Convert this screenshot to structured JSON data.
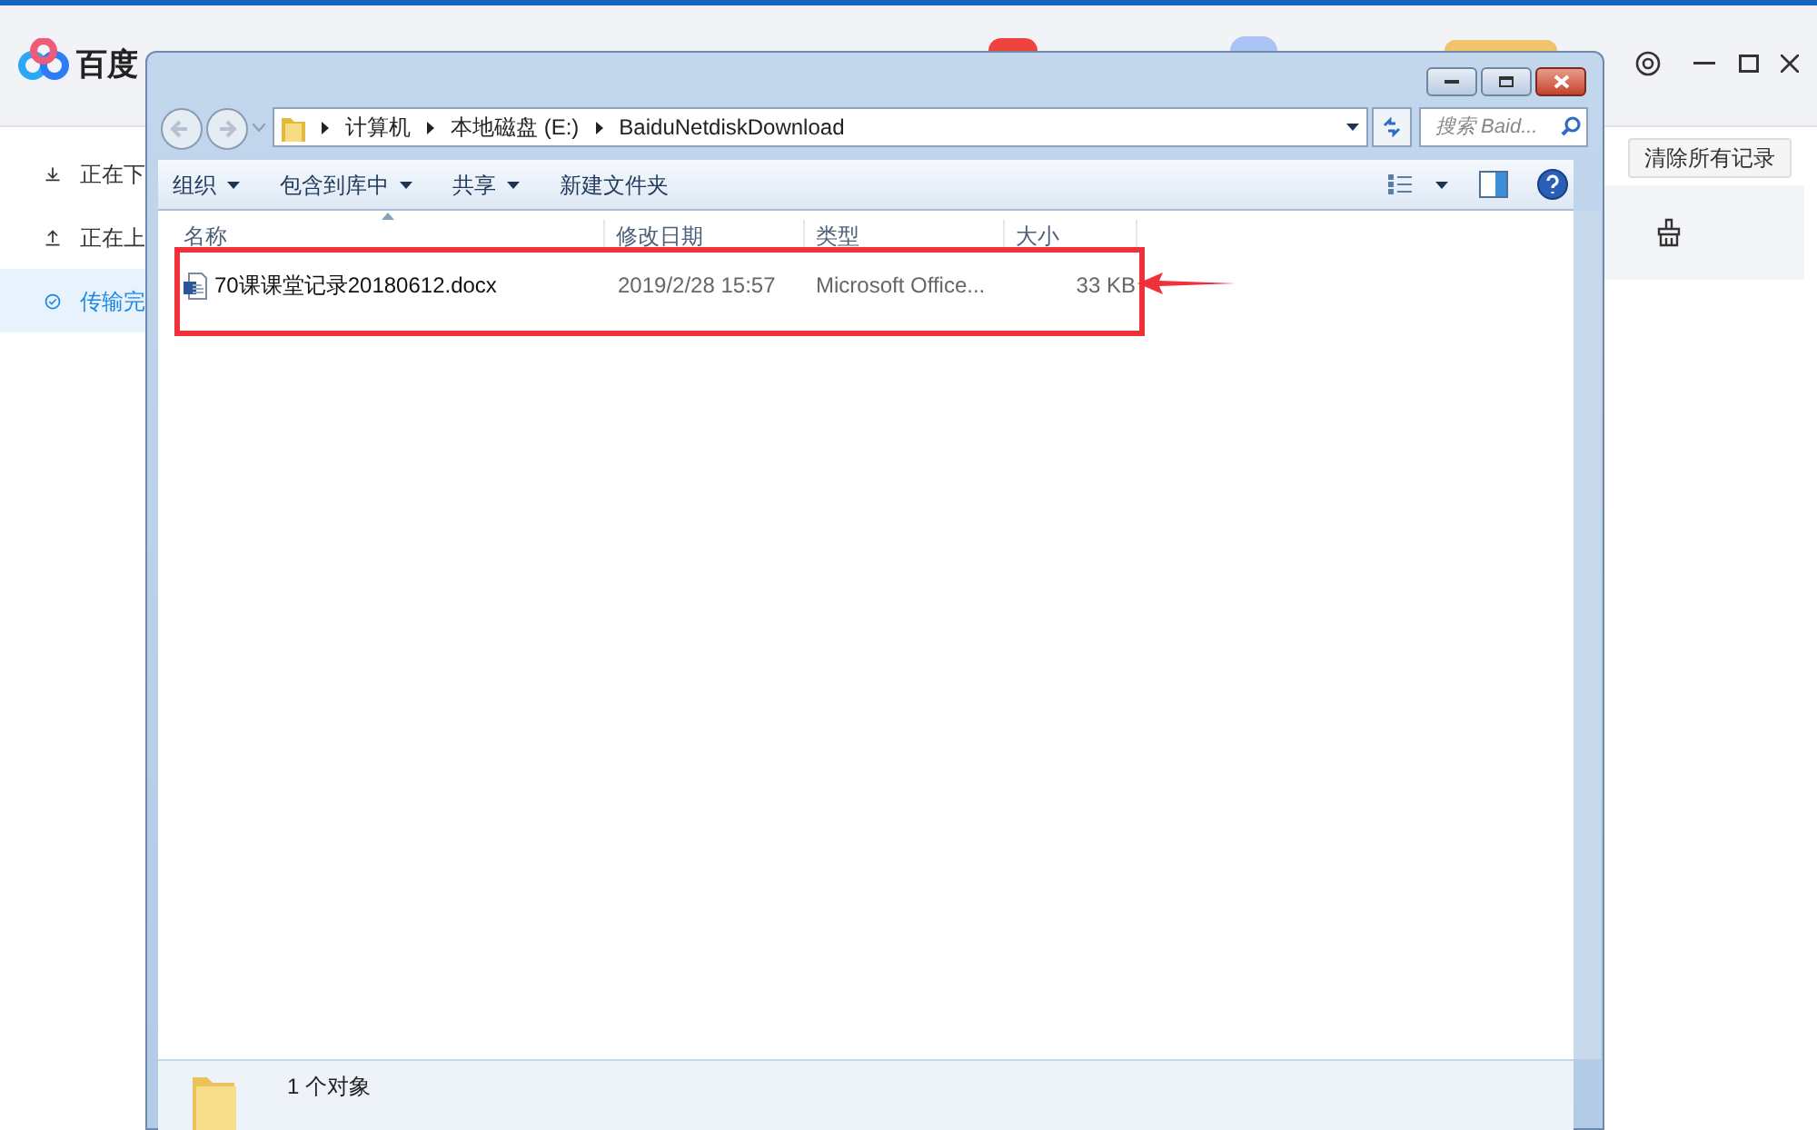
{
  "app": {
    "logo_text": "百度",
    "sidebar": [
      {
        "label": "正在下",
        "kind": "download",
        "selected": false
      },
      {
        "label": "正在上",
        "kind": "upload",
        "selected": false
      },
      {
        "label": "传输完",
        "kind": "done",
        "selected": true
      }
    ],
    "clear_button": "清除所有记录"
  },
  "explorer": {
    "breadcrumb": [
      "计算机",
      "本地磁盘 (E:)",
      "BaiduNetdiskDownload"
    ],
    "search": {
      "placeholder": "搜索 Baid..."
    },
    "toolbar": [
      {
        "label": "组织",
        "dropdown": true
      },
      {
        "label": "包含到库中",
        "dropdown": true
      },
      {
        "label": "共享",
        "dropdown": true
      },
      {
        "label": "新建文件夹",
        "dropdown": false
      }
    ],
    "columns": [
      "名称",
      "修改日期",
      "类型",
      "大小"
    ],
    "rows": [
      {
        "name": "70课课堂记录20180612.docx",
        "modified": "2019/2/28 15:57",
        "type": "Microsoft Office...",
        "size": "33 KB"
      }
    ],
    "status": "1 个对象"
  }
}
